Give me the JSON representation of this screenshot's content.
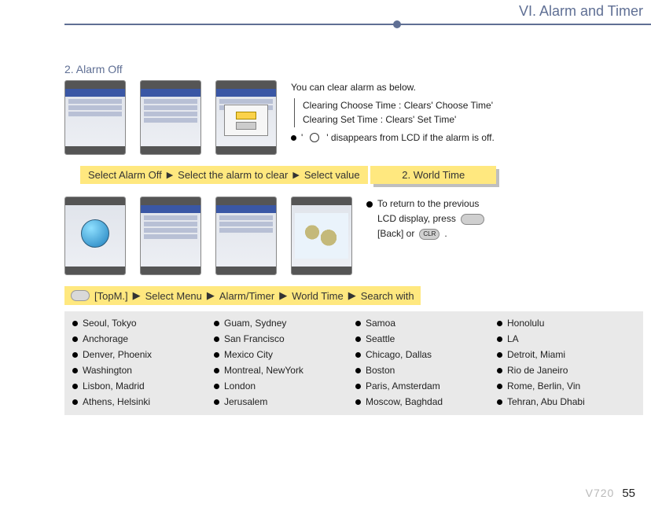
{
  "header": {
    "title": "VI. Alarm and Timer"
  },
  "section1": {
    "heading": "2. Alarm Off",
    "info_intro": "You can clear alarm as below.",
    "clear_choose": "Clearing Choose Time : Clears'  Choose Time'",
    "clear_set": "Clearing Set Time : Clears'  Set Time'",
    "disappears_a": "'",
    "disappears_b": "'  disappears from LCD if the alarm is off.",
    "path": [
      "Select Alarm Off",
      "Select the alarm to clear",
      "Select value"
    ]
  },
  "section2": {
    "tab": "2. World Time",
    "return1": "To return to the previous",
    "return2a": "LCD display, press",
    "return3a": "[Back] or",
    "return3b": ".",
    "path": [
      "[TopM.]",
      "Select Menu",
      "Alarm/Timer",
      "World Time",
      "Search with"
    ]
  },
  "cities": [
    [
      "Seoul, Tokyo",
      "Guam, Sydney",
      "Samoa",
      "Honolulu"
    ],
    [
      "Anchorage",
      "San Francisco",
      "Seattle",
      "LA"
    ],
    [
      "Denver, Phoenix",
      "Mexico City",
      "Chicago, Dallas",
      "Detroit, Miami"
    ],
    [
      "Washington",
      "Montreal, NewYork",
      "Boston",
      "Rio de Janeiro"
    ],
    [
      "Lisbon, Madrid",
      "London",
      "Paris, Amsterdam",
      "Rome, Berlin, Vin"
    ],
    [
      "Athens, Helsinki",
      "Jerusalem",
      "Moscow, Baghdad",
      "Tehran, Abu Dhabi"
    ]
  ],
  "footer": {
    "model": "V720",
    "page": "55"
  },
  "clr_label": "CLR"
}
